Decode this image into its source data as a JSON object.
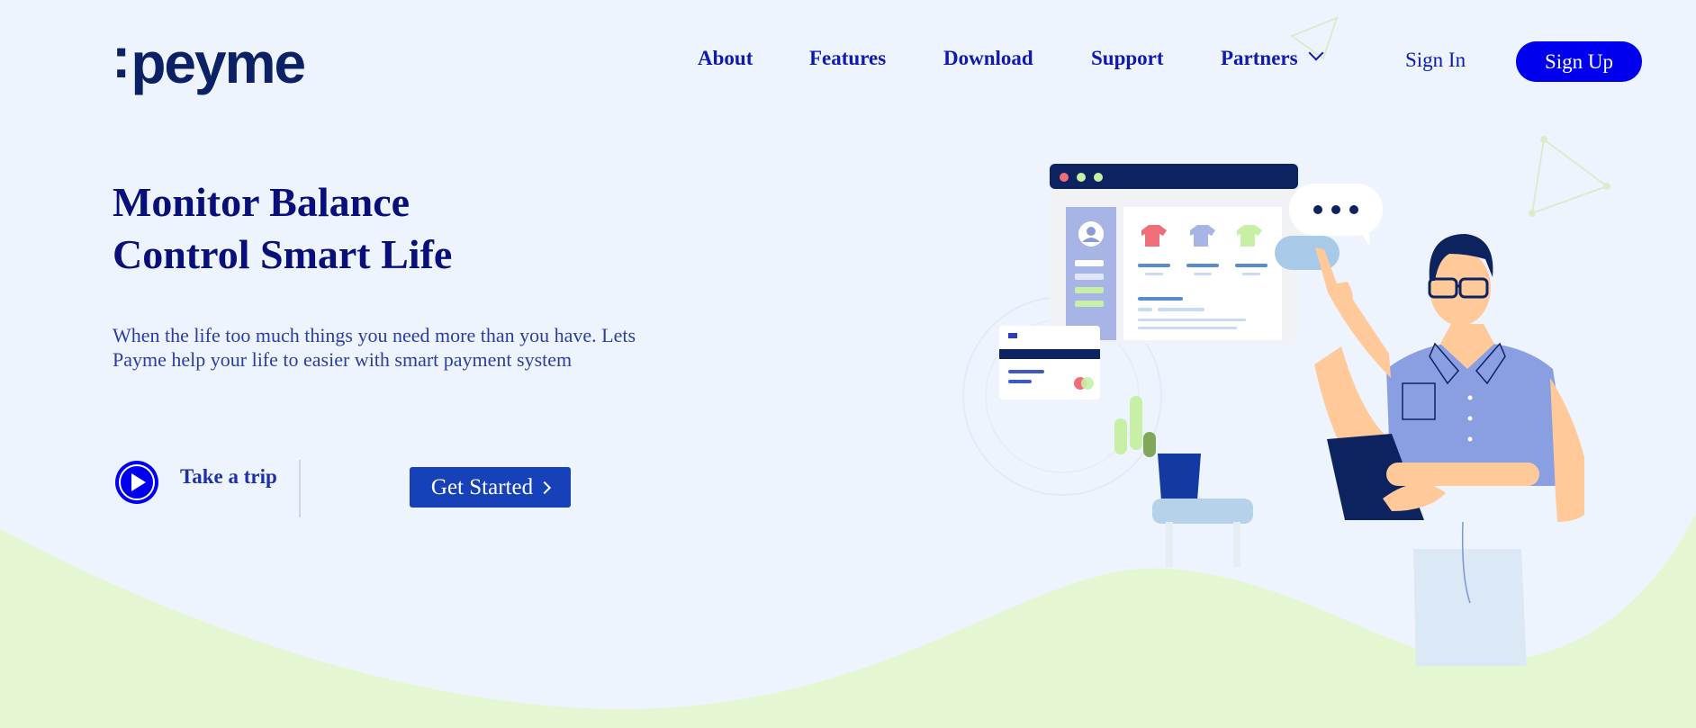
{
  "logo": {
    "colon": ":",
    "text": "peyme"
  },
  "nav": {
    "about": "About",
    "features": "Features",
    "download": "Download",
    "support": "Support",
    "partners": "Partners",
    "partners_icon": "chevron-down-icon"
  },
  "auth": {
    "sign_in": "Sign In",
    "sign_up": "Sign Up"
  },
  "hero": {
    "title_line1": "Monitor Balance",
    "title_line2": "Control Smart Life",
    "description_line1": "When the life too much things you need more than you have. Lets",
    "description_line2": "Payme help your life to easier with smart payment system",
    "take_trip": "Take a trip",
    "play_icon": "play-icon",
    "get_started": "Get Started",
    "get_started_icon": "chevron-right-icon"
  },
  "colors": {
    "background": "#eef4fe",
    "brand_blue": "#0000ee",
    "heading": "#080f78",
    "button_blue": "#1741b8",
    "wave_green": "#e4f7d2",
    "logo_navy": "#0b2163"
  }
}
